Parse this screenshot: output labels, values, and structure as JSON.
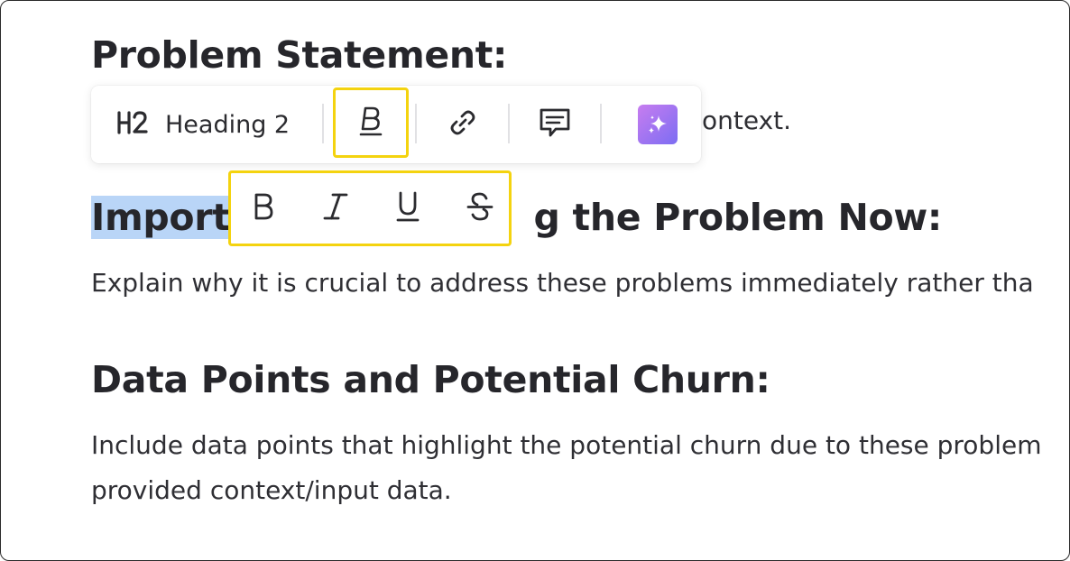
{
  "document": {
    "h_problem": "Problem Statement:",
    "p_problem_tail": "ontext.",
    "h_important_selected": "Import",
    "h_important_rest": "g the Problem Now:",
    "p_important": "Explain why it is crucial to address these problems immediately rather tha",
    "h_data": "Data Points and Potential Churn:",
    "p_data_line1": "Include data points that highlight the potential churn due to these problem",
    "p_data_line2": "provided context/input data."
  },
  "toolbar": {
    "heading_icon": "h2-icon",
    "heading_label": "Heading 2",
    "bold_icon": "bold-text-icon",
    "link_icon": "link-icon",
    "comment_icon": "comment-icon",
    "ai_icon": "ai-sparkle-icon"
  },
  "format_menu": {
    "items": [
      {
        "label": "B",
        "icon": "bold-icon"
      },
      {
        "label": "I",
        "icon": "italic-icon"
      },
      {
        "label": "U",
        "icon": "underline-icon"
      },
      {
        "label": "S",
        "icon": "strikethrough-icon"
      }
    ]
  },
  "colors": {
    "highlight": "#f4d30f",
    "selection": "#b9d5f7",
    "ai_gradient_start": "#c77df0",
    "ai_gradient_end": "#7c6df2"
  }
}
